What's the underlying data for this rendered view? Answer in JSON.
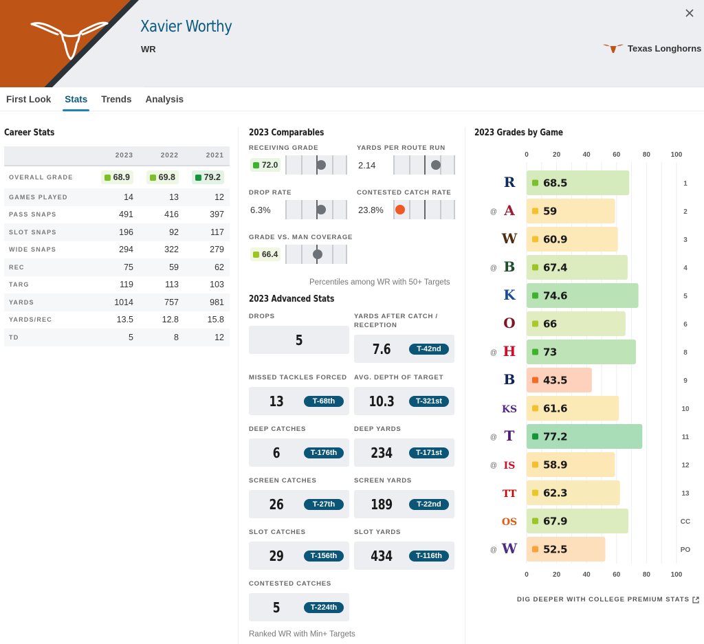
{
  "header": {
    "player_name": "Xavier Worthy",
    "position": "WR",
    "team_name": "Texas Longhorns",
    "team_color": "#bf5417",
    "close_icon": "close-icon",
    "logo_icon": "longhorn-icon"
  },
  "tabs": [
    {
      "label": "First Look",
      "active": false
    },
    {
      "label": "Stats",
      "active": true
    },
    {
      "label": "Trends",
      "active": false
    },
    {
      "label": "Analysis",
      "active": false
    }
  ],
  "career_stats": {
    "title": "Career Stats",
    "columns": [
      "2023",
      "2022",
      "2021"
    ],
    "overall_grade": {
      "label": "OVERALL GRADE",
      "values": [
        {
          "value": "68.9",
          "color": "#7cbf2a",
          "bg": "#eef6e4"
        },
        {
          "value": "69.8",
          "color": "#7cbf2a",
          "bg": "#eef6e4"
        },
        {
          "value": "79.2",
          "color": "#13953a",
          "bg": "#e2f3e6"
        }
      ]
    },
    "rows": [
      {
        "label": "GAMES PLAYED",
        "values": [
          "14",
          "13",
          "12"
        ]
      },
      {
        "label": "PASS SNAPS",
        "values": [
          "491",
          "416",
          "397"
        ]
      },
      {
        "label": "SLOT SNAPS",
        "values": [
          "196",
          "92",
          "117"
        ]
      },
      {
        "label": "WIDE SNAPS",
        "values": [
          "294",
          "322",
          "279"
        ]
      },
      {
        "label": "REC",
        "values": [
          "75",
          "59",
          "62"
        ]
      },
      {
        "label": "TARG",
        "values": [
          "119",
          "113",
          "103"
        ]
      },
      {
        "label": "YARDS",
        "values": [
          "1014",
          "757",
          "981"
        ]
      },
      {
        "label": "YARDS/REC",
        "values": [
          "13.5",
          "12.8",
          "15.8"
        ]
      },
      {
        "label": "TD",
        "values": [
          "5",
          "8",
          "12"
        ]
      }
    ]
  },
  "comparables": {
    "title": "2023 Comparables",
    "items": [
      {
        "label": "RECEIVING GRADE",
        "value": "72.0",
        "is_grade": true,
        "grade_color": "#3cb22e",
        "grade_bg": "#e8f5e3",
        "percentile": 58,
        "dot_color": "#6d7178"
      },
      {
        "label": "YARDS PER ROUTE RUN",
        "value": "2.14",
        "is_grade": false,
        "percentile": 69,
        "dot_color": "#6d7178"
      },
      {
        "label": "DROP RATE",
        "value": "6.3%",
        "is_grade": false,
        "percentile": 58,
        "dot_color": "#6d7178"
      },
      {
        "label": "CONTESTED CATCH RATE",
        "value": "23.8%",
        "is_grade": false,
        "percentile": 11,
        "dot_color": "#f05a22"
      },
      {
        "label": "GRADE VS. MAN COVERAGE",
        "value": "66.4",
        "is_grade": true,
        "grade_color": "#9cc523",
        "grade_bg": "#f1f7e2",
        "percentile": 52,
        "dot_color": "#6d7178"
      }
    ],
    "note": "Percentiles among WR with 50+ Targets"
  },
  "advanced_stats": {
    "title": "2023 Advanced Stats",
    "items": [
      {
        "label": "DROPS",
        "value": "5",
        "rank": null
      },
      {
        "label": "YARDS AFTER CATCH / RECEPTION",
        "value": "7.6",
        "rank": "T-42nd"
      },
      {
        "label": "MISSED TACKLES FORCED",
        "value": "13",
        "rank": "T-68th"
      },
      {
        "label": "AVG. DEPTH OF TARGET",
        "value": "10.3",
        "rank": "T-321st"
      },
      {
        "label": "DEEP CATCHES",
        "value": "6",
        "rank": "T-176th"
      },
      {
        "label": "DEEP YARDS",
        "value": "234",
        "rank": "T-171st"
      },
      {
        "label": "SCREEN CATCHES",
        "value": "26",
        "rank": "T-27th"
      },
      {
        "label": "SCREEN YARDS",
        "value": "189",
        "rank": "T-22nd"
      },
      {
        "label": "SLOT CATCHES",
        "value": "29",
        "rank": "T-156th"
      },
      {
        "label": "SLOT YARDS",
        "value": "434",
        "rank": "T-116th"
      },
      {
        "label": "CONTESTED CATCHES",
        "value": "5",
        "rank": "T-224th"
      }
    ],
    "note": "Ranked WR with Min+ Targets"
  },
  "chart_data": {
    "type": "bar",
    "orientation": "horizontal",
    "title": "2023 Grades by Game",
    "xlim": [
      0,
      100
    ],
    "xticks": [
      0,
      20,
      40,
      60,
      80,
      100
    ],
    "grid": true,
    "games": [
      {
        "opponent": "Rice",
        "away": false,
        "week": "1",
        "grade": 68.5,
        "label": "68.5",
        "dot": "#7cbf2a",
        "bar": "#d6ebbd",
        "logo": "rice-logo-icon",
        "logo_color": "#0d2b5b"
      },
      {
        "opponent": "Alabama",
        "away": true,
        "week": "2",
        "grade": 59,
        "label": "59",
        "dot": "#f5c02e",
        "bar": "#fde9b8",
        "logo": "alabama-logo-icon",
        "logo_color": "#9e1b32"
      },
      {
        "opponent": "Wyoming",
        "away": false,
        "week": "3",
        "grade": 60.9,
        "label": "60.9",
        "dot": "#f5c02e",
        "bar": "#fde9b8",
        "logo": "wyoming-logo-icon",
        "logo_color": "#4f2d11"
      },
      {
        "opponent": "Baylor",
        "away": true,
        "week": "4",
        "grade": 67.4,
        "label": "67.4",
        "dot": "#9cc523",
        "bar": "#dcecbf",
        "logo": "baylor-logo-icon",
        "logo_color": "#1c4e2c"
      },
      {
        "opponent": "Kansas",
        "away": false,
        "week": "5",
        "grade": 74.6,
        "label": "74.6",
        "dot": "#3cb22e",
        "bar": "#b9e2b6",
        "logo": "kansas-logo-icon",
        "logo_color": "#1b4b9b"
      },
      {
        "opponent": "Oklahoma",
        "away": false,
        "week": "6",
        "grade": 66,
        "label": "66",
        "dot": "#a9c82a",
        "bar": "#e2ecc1",
        "logo": "oklahoma-logo-icon",
        "logo_color": "#7d1425"
      },
      {
        "opponent": "Houston",
        "away": true,
        "week": "8",
        "grade": 73,
        "label": "73",
        "dot": "#3cb22e",
        "bar": "#bde3b6",
        "logo": "houston-logo-icon",
        "logo_color": "#c8102e"
      },
      {
        "opponent": "BYU",
        "away": false,
        "week": "9",
        "grade": 43.5,
        "label": "43.5",
        "dot": "#f26d21",
        "bar": "#fdd1bb",
        "logo": "byu-logo-icon",
        "logo_color": "#0d2554"
      },
      {
        "opponent": "Kansas State",
        "away": false,
        "week": "10",
        "grade": 61.6,
        "label": "61.6",
        "dot": "#f5c02e",
        "bar": "#fbe9b6",
        "logo": "kansas-state-logo-icon",
        "logo_color": "#512888"
      },
      {
        "opponent": "TCU",
        "away": true,
        "week": "11",
        "grade": 77.2,
        "label": "77.2",
        "dot": "#13953a",
        "bar": "#a8ddb8",
        "logo": "tcu-logo-icon",
        "logo_color": "#4d1979"
      },
      {
        "opponent": "Iowa State",
        "away": true,
        "week": "12",
        "grade": 58.9,
        "label": "58.9",
        "dot": "#f5c02e",
        "bar": "#fde7b4",
        "logo": "iowa-state-logo-icon",
        "logo_color": "#c8102e"
      },
      {
        "opponent": "Texas Tech",
        "away": false,
        "week": "13",
        "grade": 62.3,
        "label": "62.3",
        "dot": "#e9c72b",
        "bar": "#f8ebb9",
        "logo": "texas-tech-logo-icon",
        "logo_color": "#cc0000"
      },
      {
        "opponent": "Oklahoma State",
        "away": false,
        "week": "CC",
        "grade": 67.9,
        "label": "67.9",
        "dot": "#9cc523",
        "bar": "#dcecbf",
        "logo": "oklahoma-state-logo-icon",
        "logo_color": "#e05a14"
      },
      {
        "opponent": "Washington",
        "away": true,
        "week": "PO",
        "grade": 52.5,
        "label": "52.5",
        "dot": "#f8a33a",
        "bar": "#fddfbb",
        "logo": "washington-logo-icon",
        "logo_color": "#4b2e83"
      }
    ],
    "away_marker": "@"
  },
  "footer": {
    "dig_deeper_label": "DIG DEEPER WITH COLLEGE PREMIUM STATS",
    "external_icon": "external-link-icon"
  }
}
